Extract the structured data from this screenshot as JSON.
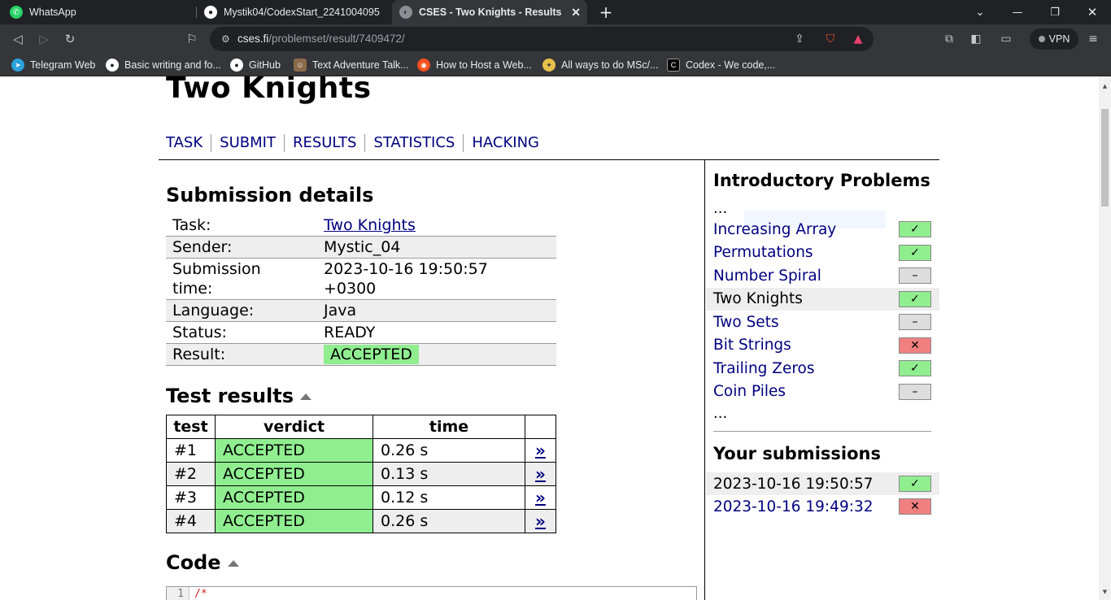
{
  "browser": {
    "tabs": [
      {
        "title": "WhatsApp",
        "icon": "whatsapp-icon"
      },
      {
        "title": "Mystik04/CodexStart_2241004095",
        "icon": "github-icon"
      },
      {
        "title": "CSES - Two Knights - Results",
        "icon": "globe-icon"
      }
    ],
    "url_host": "cses.fi",
    "url_path": "/problemset/result/7409472/",
    "vpn_label": "VPN",
    "bookmarks": [
      {
        "label": "Telegram Web",
        "icon": "telegram-icon"
      },
      {
        "label": "Basic writing and fo...",
        "icon": "github-icon"
      },
      {
        "label": "GitHub",
        "icon": "github-icon"
      },
      {
        "label": "Text Adventure Talk...",
        "icon": "avatar-icon"
      },
      {
        "label": "How to Host a Web...",
        "icon": "orange-icon"
      },
      {
        "label": "All ways to do MSc/...",
        "icon": "compass-icon"
      },
      {
        "label": "Codex - We code,...",
        "icon": "codex-icon"
      }
    ]
  },
  "page": {
    "title": "Two Knights",
    "nav": [
      "TASK",
      "SUBMIT",
      "RESULTS",
      "STATISTICS",
      "HACKING"
    ],
    "details_heading": "Submission details",
    "details": {
      "task_label": "Task:",
      "task_value": "Two Knights",
      "sender_label": "Sender:",
      "sender_value": "Mystic_04",
      "time_label_1": "Submission",
      "time_label_2": "time:",
      "time_value_1": "2023-10-16 19:50:57",
      "time_value_2": "+0300",
      "language_label": "Language:",
      "language_value": "Java",
      "status_label": "Status:",
      "status_value": "READY",
      "result_label": "Result:",
      "result_value": "ACCEPTED"
    },
    "tests_heading": "Test results",
    "tests_columns": [
      "test",
      "verdict",
      "time"
    ],
    "tests": [
      {
        "test": "#1",
        "verdict": "ACCEPTED",
        "time": "0.26 s",
        "link": "»"
      },
      {
        "test": "#2",
        "verdict": "ACCEPTED",
        "time": "0.13 s",
        "link": "»"
      },
      {
        "test": "#3",
        "verdict": "ACCEPTED",
        "time": "0.12 s",
        "link": "»"
      },
      {
        "test": "#4",
        "verdict": "ACCEPTED",
        "time": "0.26 s",
        "link": "»"
      }
    ],
    "code_heading": "Code",
    "code_line_no": "1",
    "code_line": "/*"
  },
  "sidebar": {
    "problems_heading": "Introductory Problems",
    "ellipsis_top": "...",
    "ellipsis_bottom": "...",
    "problems": [
      {
        "name": "Increasing Array",
        "status": "✓",
        "state": "ok"
      },
      {
        "name": "Permutations",
        "status": "✓",
        "state": "ok"
      },
      {
        "name": "Number Spiral",
        "status": "–",
        "state": "none"
      },
      {
        "name": "Two Knights",
        "status": "✓",
        "state": "ok"
      },
      {
        "name": "Two Sets",
        "status": "–",
        "state": "none"
      },
      {
        "name": "Bit Strings",
        "status": "✕",
        "state": "fail"
      },
      {
        "name": "Trailing Zeros",
        "status": "✓",
        "state": "ok"
      },
      {
        "name": "Coin Piles",
        "status": "–",
        "state": "none"
      }
    ],
    "submissions_heading": "Your submissions",
    "submissions": [
      {
        "time": "2023-10-16 19:50:57",
        "status": "✓",
        "state": "ok"
      },
      {
        "time": "2023-10-16 19:49:32",
        "status": "✕",
        "state": "fail"
      }
    ]
  },
  "colors": {
    "accepted": "#90ee90",
    "failed": "#f08080",
    "link": "#000080"
  }
}
